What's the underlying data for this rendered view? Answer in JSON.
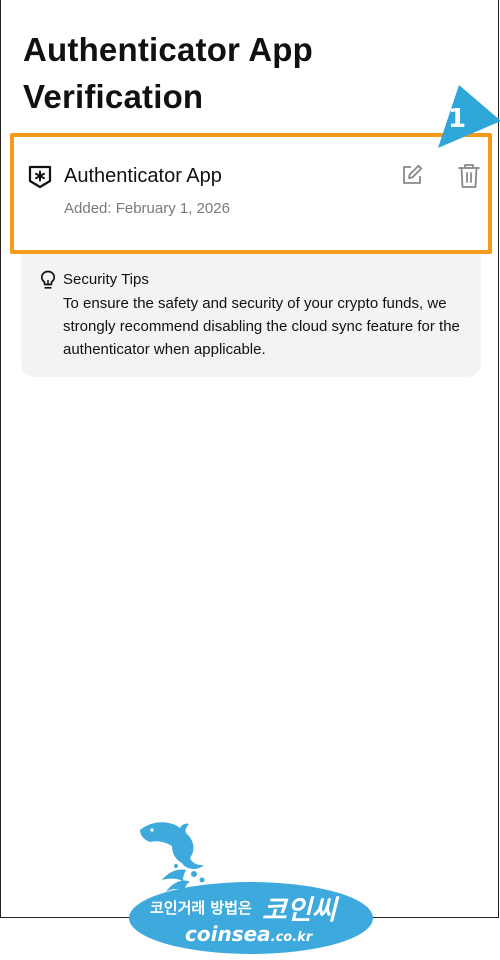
{
  "page": {
    "title": "Authenticator App Verification"
  },
  "authenticator": {
    "name": "Authenticator App",
    "added": "Added: February 1, 2026",
    "icon": "shield-asterisk-icon",
    "actions": [
      "edit-icon",
      "trash-icon"
    ]
  },
  "annotation": {
    "number": "1",
    "color": "#2fa6d8",
    "highlight_color": "#f59a1b"
  },
  "security_tips": {
    "icon": "lightbulb-icon",
    "title": "Security Tips",
    "body": "To ensure the safety and security of your crypto funds, we strongly recommend disabling the cloud sync feature for the authenticator when applicable."
  },
  "watermark": {
    "line1": "코인거래 방법은",
    "brand": "코인씨",
    "site_main": "coinsea",
    "site_suffix": ".co.kr",
    "color": "#3ea9dc"
  }
}
